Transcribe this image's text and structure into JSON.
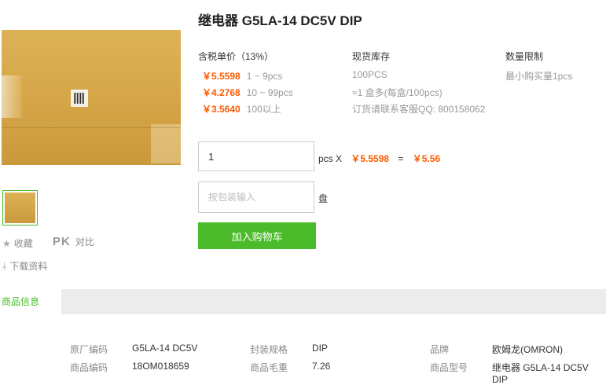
{
  "product": {
    "title": "继电器 G5LA-14 DC5V DIP"
  },
  "gallery": {
    "main_image_alt": "product-photo",
    "thumbnail_count": 1
  },
  "actions": {
    "favorite_label": "收藏",
    "pk_label": "PK",
    "compare_label": "对比",
    "download_label": "下载资料"
  },
  "pricing": {
    "header": "含税单价（13%）",
    "tiers": [
      {
        "price": "￥5.5598",
        "qty": "1 ~ 9pcs"
      },
      {
        "price": "￥4.2768",
        "qty": "10 ~ 99pcs"
      },
      {
        "price": "￥3.5640",
        "qty": "100以上"
      }
    ]
  },
  "stock": {
    "header": "现货库存",
    "amount": "100PCS",
    "pack": "≈1 盒多(每盒/100pcs)",
    "contact": "订货请联系客服QQ: 800158062"
  },
  "limit": {
    "header": "数量限制",
    "min": "最小购买量1pcs"
  },
  "order": {
    "qty_value": "1",
    "unit_x": "pcs X",
    "unit_price": "￥5.5598",
    "equals": "=",
    "total": "￥5.56",
    "pkg_placeholder": "按包装输入",
    "pkg_unit": "盘",
    "buy_label": "加入购物车"
  },
  "tabs": {
    "active": "商品信息"
  },
  "specs": [
    {
      "k": "原厂编码",
      "v": "G5LA-14 DC5V"
    },
    {
      "k": "封装规格",
      "v": "DIP"
    },
    {
      "k": "品牌",
      "v": "欧姆龙(OMRON)"
    },
    {
      "k": "商品编码",
      "v": "18OM018659"
    },
    {
      "k": "商品毛重",
      "v": "7.26"
    },
    {
      "k": "商品型号",
      "v": "继电器 G5LA-14 DC5V DIP"
    }
  ],
  "colors": {
    "accent_green": "#4bbb2b",
    "price_orange": "#ff5a00"
  }
}
